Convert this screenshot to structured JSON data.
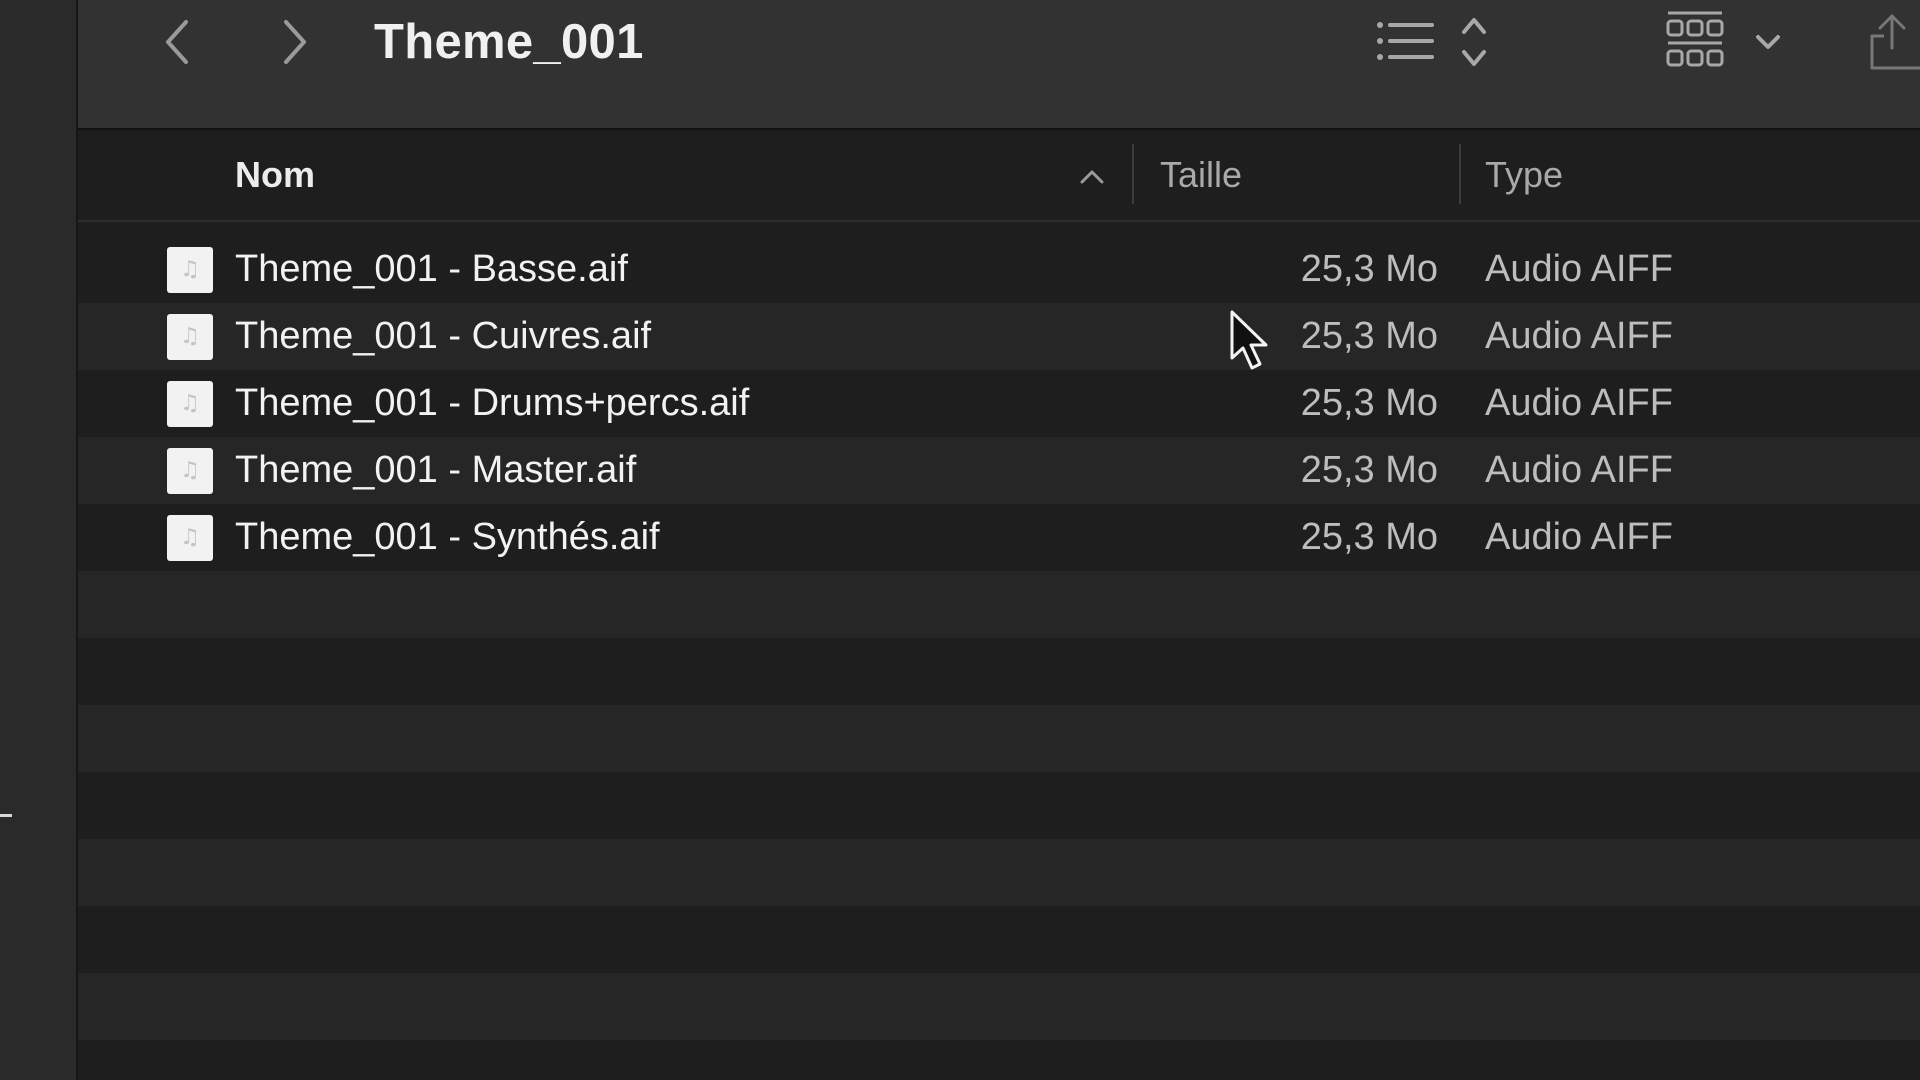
{
  "window": {
    "title": "Theme_001"
  },
  "toolbar": {
    "back_icon": "chevron-left-icon",
    "forward_icon": "chevron-right-icon",
    "view_icon": "list-view-icon",
    "group_icon": "grid-group-icon",
    "share_icon": "share-icon"
  },
  "columns": {
    "name": "Nom",
    "size": "Taille",
    "type": "Type",
    "sort": "ascending"
  },
  "files": [
    {
      "name": "Theme_001 - Basse.aif",
      "size": "25,3 Mo",
      "type": "Audio AIFF"
    },
    {
      "name": "Theme_001 - Cuivres.aif",
      "size": "25,3 Mo",
      "type": "Audio AIFF"
    },
    {
      "name": "Theme_001 - Drums+percs.aif",
      "size": "25,3 Mo",
      "type": "Audio AIFF"
    },
    {
      "name": "Theme_001 - Master.aif",
      "size": "25,3 Mo",
      "type": "Audio AIFF"
    },
    {
      "name": "Theme_001 - Synthés.aif",
      "size": "25,3 Mo",
      "type": "Audio AIFF"
    }
  ],
  "colors": {
    "background": "#1e1e1e",
    "toolbar": "#323232",
    "row_alt": "#262626",
    "text_primary": "#f2f2f2",
    "text_secondary": "#bdbdbd"
  }
}
